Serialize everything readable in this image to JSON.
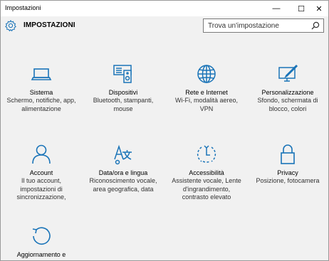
{
  "window": {
    "title": "Impostazioni",
    "minimize_glyph": "—",
    "maximize_glyph": "☐",
    "close_glyph": "✕"
  },
  "header": {
    "title": "IMPOSTAZIONI",
    "icon": "gear-icon"
  },
  "search": {
    "placeholder": "Trova un'impostazione",
    "icon": "search-icon"
  },
  "accent_color": "#1a74b8",
  "tiles": [
    {
      "name": "Sistema",
      "desc": [
        "Schermo, notifiche, app,",
        "alimentazione"
      ],
      "icon": "laptop-icon"
    },
    {
      "name": "Dispositivi",
      "desc": [
        "Bluetooth, stampanti,",
        "mouse"
      ],
      "icon": "devices-icon"
    },
    {
      "name": "Rete e Internet",
      "desc": [
        "Wi-Fi, modalità aereo,",
        "VPN"
      ],
      "icon": "globe-icon"
    },
    {
      "name": "Personalizzazione",
      "desc": [
        "Sfondo, schermata di",
        "blocco, colori"
      ],
      "icon": "paint-icon"
    },
    {
      "name": "Account",
      "desc": [
        "Il tuo account,",
        "impostazioni di",
        "sincronizzazione,"
      ],
      "icon": "person-icon"
    },
    {
      "name": "Data/ora e lingua",
      "desc": [
        "Riconoscimento vocale,",
        "area geografica, data"
      ],
      "icon": "time-language-icon"
    },
    {
      "name": "Accessibilità",
      "desc": [
        "Assistente vocale, Lente",
        "d'ingrandimento,",
        "contrasto elevato"
      ],
      "icon": "accessibility-icon"
    },
    {
      "name": "Privacy",
      "desc": [
        "Posizione, fotocamera"
      ],
      "icon": "lock-icon"
    },
    {
      "name": "Aggiornamento e",
      "desc": [],
      "icon": "update-icon"
    }
  ]
}
